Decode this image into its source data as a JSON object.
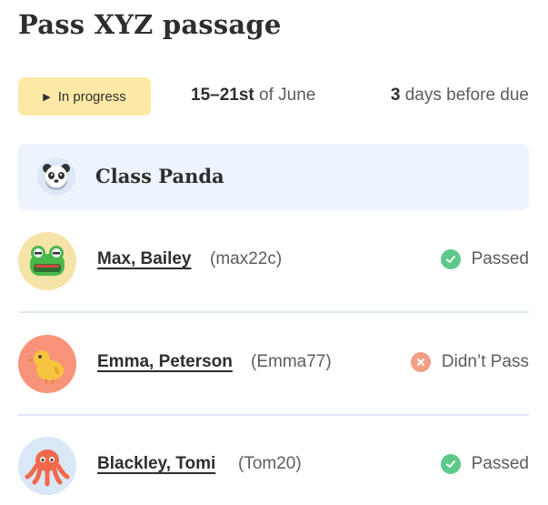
{
  "page": {
    "title": "Pass XYZ passage"
  },
  "assignment": {
    "status": "In progress",
    "date_range_bold": "15–21st",
    "date_range_rest": " of June",
    "due_bold": "3",
    "due_rest": " days before due"
  },
  "class": {
    "name": "Class Panda",
    "icon": "panda-icon"
  },
  "students": [
    {
      "name": "Max, Bailey",
      "id": "(max22c)",
      "result": "Passed",
      "avatar_icon": "frog-icon",
      "avatar_color": "#f6e3a8",
      "status_color": "#5cc98a"
    },
    {
      "name": "Emma, Peterson",
      "id": "(Emma77)",
      "result": "Didn’t Pass",
      "avatar_icon": "chick-icon",
      "avatar_color": "#f8937a",
      "status_color": "#f2a084"
    },
    {
      "name": "Blackley, Tomi",
      "id": "(Tom20)",
      "result": "Passed",
      "avatar_icon": "octopus-icon",
      "avatar_color": "#d9e7f7",
      "status_color": "#5cc98a"
    }
  ],
  "colors": {
    "pill_bg": "#fde9a6",
    "class_bg": "#eef4fd",
    "divider": "#dfe8f4"
  }
}
